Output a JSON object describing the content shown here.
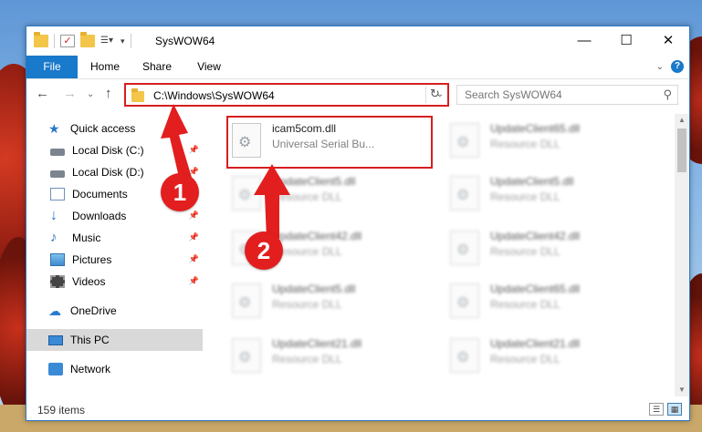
{
  "window": {
    "title": "SysWOW64",
    "minimize_glyph": "—",
    "maximize_glyph": "☐",
    "close_glyph": "✕"
  },
  "ribbon": {
    "tabs": [
      {
        "label": "File"
      },
      {
        "label": "Home"
      },
      {
        "label": "Share"
      },
      {
        "label": "View"
      }
    ],
    "help_glyph": "?"
  },
  "navigation": {
    "address": "C:\\Windows\\SysWOW64",
    "search_placeholder": "Search SysWOW64"
  },
  "sidebar": {
    "items": [
      {
        "label": "Quick access",
        "icon": "star-icon",
        "pinned": false
      },
      {
        "label": "Local Disk (C:)",
        "icon": "disk-icon",
        "pinned": true
      },
      {
        "label": "Local Disk (D:)",
        "icon": "disk-icon",
        "pinned": true
      },
      {
        "label": "Documents",
        "icon": "document-icon",
        "pinned": true
      },
      {
        "label": "Downloads",
        "icon": "download-icon",
        "pinned": true
      },
      {
        "label": "Music",
        "icon": "music-icon",
        "pinned": true
      },
      {
        "label": "Pictures",
        "icon": "picture-icon",
        "pinned": true
      },
      {
        "label": "Videos",
        "icon": "video-icon",
        "pinned": true
      },
      {
        "label": "OneDrive",
        "icon": "cloud-icon",
        "pinned": false
      },
      {
        "label": "This PC",
        "icon": "computer-icon",
        "pinned": false,
        "selected": true
      },
      {
        "label": "Network",
        "icon": "network-icon",
        "pinned": false
      }
    ]
  },
  "files": [
    {
      "name": "icam5com.dll",
      "type": "Universal Serial Bu...",
      "highlighted": true
    },
    {
      "name": "UpdateClient65.dll",
      "type": "Resource DLL"
    },
    {
      "name": "UpdateClient5.dll",
      "type": "Resource DLL"
    },
    {
      "name": "UpdateClient5.dll",
      "type": "Resource DLL"
    },
    {
      "name": "UpdateClient42.dll",
      "type": "Resource DLL"
    },
    {
      "name": "UpdateClient42.dll",
      "type": "Resource DLL"
    },
    {
      "name": "UpdateClient5.dll",
      "type": "Resource DLL"
    },
    {
      "name": "UpdateClient65.dll",
      "type": "Resource DLL"
    },
    {
      "name": "UpdateClient21.dll",
      "type": "Resource DLL"
    },
    {
      "name": "UpdateClient21.dll",
      "type": "Resource DLL"
    }
  ],
  "status": {
    "item_count": "159 items"
  },
  "annotations": {
    "step1": "1",
    "step2": "2",
    "color": "#e21e1e"
  }
}
